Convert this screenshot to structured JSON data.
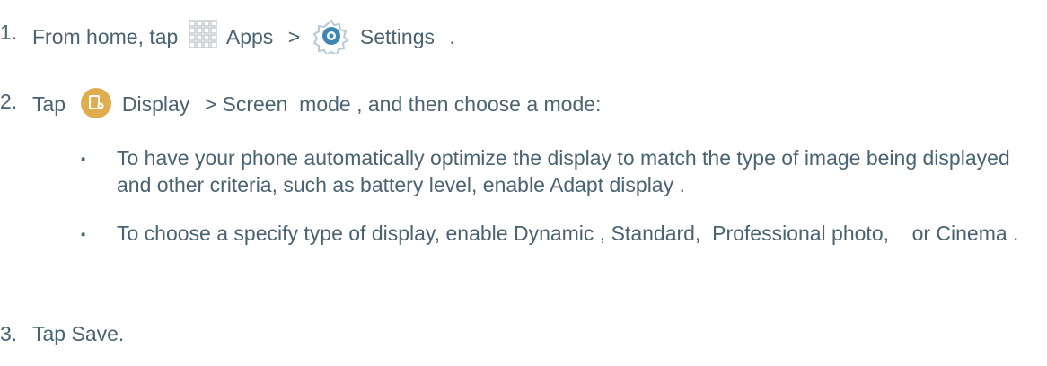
{
  "steps": [
    {
      "number": "1.",
      "text_a": "From home, tap",
      "icon_a": "apps-grid-icon",
      "label_a": "Apps",
      "sep": ">",
      "icon_b": "settings-gear-icon",
      "label_b": "Settings",
      "end": "."
    },
    {
      "number": "2.",
      "text_a": "Tap",
      "icon_a": "display-icon",
      "label_a": "Display",
      "rest": "> Screen  mode , and then choose a mode:",
      "bullets": [
        "To have your phone automatically optimize the display to match the type of image being displayed and other criteria, such as battery level, enable Adapt display  .",
        "To choose a specify type of display, enable Dynamic , Standard,  Professional photo,    or Cinema ."
      ]
    },
    {
      "number": "3.",
      "text": "Tap Save."
    }
  ],
  "bullet_glyph": "▪",
  "colors": {
    "text": "#4a6372",
    "display_icon": "#e0ad4e",
    "settings_icon": "#3f86b5",
    "grid_icon": "#b9c0c6"
  }
}
